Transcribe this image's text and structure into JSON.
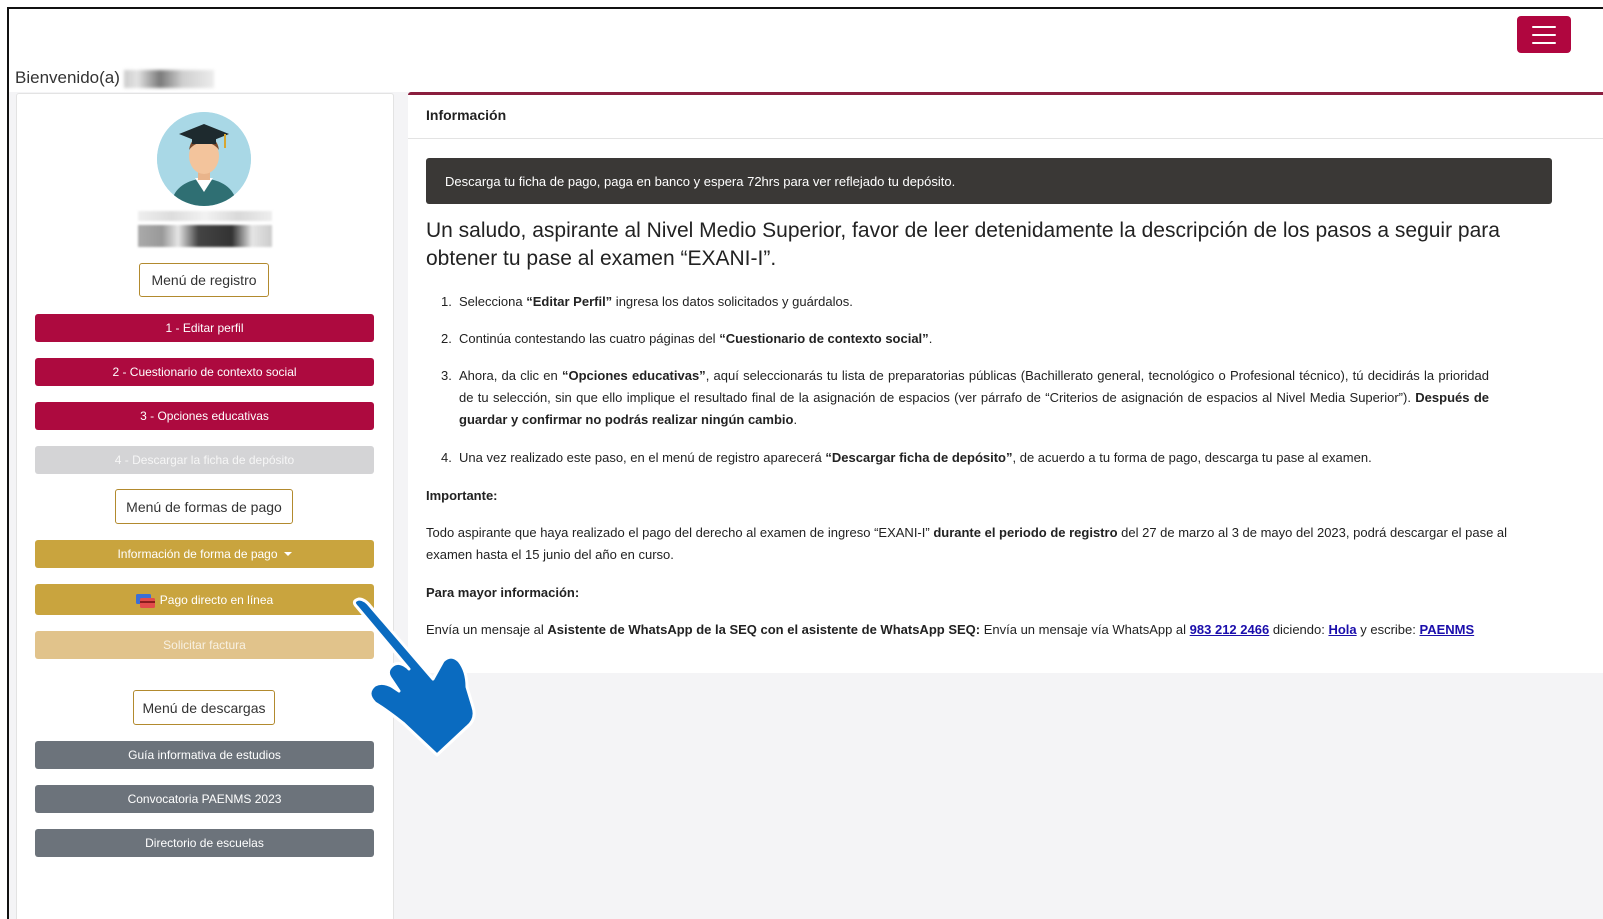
{
  "header": {
    "welcome_prefix": "Bienvenido(a)"
  },
  "sidebar": {
    "menu_registro": "Menú de registro",
    "registro_items": [
      {
        "label": "1 - Editar perfil"
      },
      {
        "label": "2 - Cuestionario de contexto social"
      },
      {
        "label": "3 - Opciones educativas"
      },
      {
        "label": "4 - Descargar la ficha de depósito"
      }
    ],
    "menu_pago": "Menú de formas de pago",
    "pago_items": [
      {
        "label": "Información de forma de pago"
      },
      {
        "label": "Pago directo en línea"
      },
      {
        "label": "Solicitar factura"
      }
    ],
    "menu_descargas": "Menú de descargas",
    "descargas_items": [
      {
        "label": "Guía informativa de estudios"
      },
      {
        "label": "Convocatoria PAENMS 2023"
      },
      {
        "label": "Directorio de escuelas"
      }
    ]
  },
  "main": {
    "title": "Información",
    "alert": "Descarga tu ficha de pago, paga en banco y espera 72hrs para ver reflejado tu depósito.",
    "headline": "Un saludo, aspirante al Nivel Medio Superior, favor de leer detenidamente la descripción de los pasos a seguir para obtener tu pase al examen “EXANI-I”.",
    "steps": [
      {
        "num": "1.",
        "pre": "Selecciona ",
        "bold": "“Editar Perfil”",
        "post": " ingresa los datos solicitados y guárdalos."
      },
      {
        "num": "2.",
        "pre": "Continúa contestando las cuatro páginas del ",
        "bold": "“Cuestionario de contexto social”",
        "post": "."
      },
      {
        "num": "3.",
        "pre": "Ahora, da clic en ",
        "bold": "“Opciones educativas”",
        "post": ", aquí seleccionarás tu lista de preparatorias públicas (Bachillerato general, tecnológico o Profesional técnico), tú decidirás la prioridad de tu selección, sin que ello implique el resultado final de la asignación de espacios (ver párrafo de “Criterios de asignación de espacios al Nivel Media Superior”). ",
        "bold2": "Después de guardar y confirmar no podrás realizar ningún cambio",
        "post2": "."
      },
      {
        "num": "4.",
        "pre": "Una vez realizado este paso, en el menú de registro aparecerá ",
        "bold": "“Descargar ficha de depósito”",
        "post": ", de acuerdo a tu forma de pago, descarga tu pase al examen."
      }
    ],
    "importante_title": "Importante:",
    "importante_pre": "Todo aspirante que haya realizado el pago del derecho al examen de ingreso “EXANI-I” ",
    "importante_bold": "durante el periodo de registro",
    "importante_post": " del 27 de marzo al 3 de mayo del 2023, podrá descargar el pase al examen hasta el 15 junio del año en curso.",
    "info_title": "Para mayor información:",
    "info_pre": "Envía un mensaje al ",
    "info_bold": "Asistente de WhatsApp de la SEQ con el asistente de WhatsApp SEQ:",
    "info_mid": " Envía un mensaje vía WhatsApp al ",
    "info_phone": "983 212 2466",
    "info_mid2": " diciendo: ",
    "info_hola": "Hola",
    "info_mid3": " y escribe: ",
    "info_paenms": "PAENMS"
  },
  "colors": {
    "primary": "#ad0a3f",
    "gold": "#c9a43e",
    "gray": "#6c737b",
    "alert_bg": "#3a3836",
    "pointer_hand": "#0a6bc0"
  },
  "icons": [
    "hamburger-icon",
    "graduate-avatar",
    "credit-card-icon",
    "pointing-hand-icon"
  ]
}
